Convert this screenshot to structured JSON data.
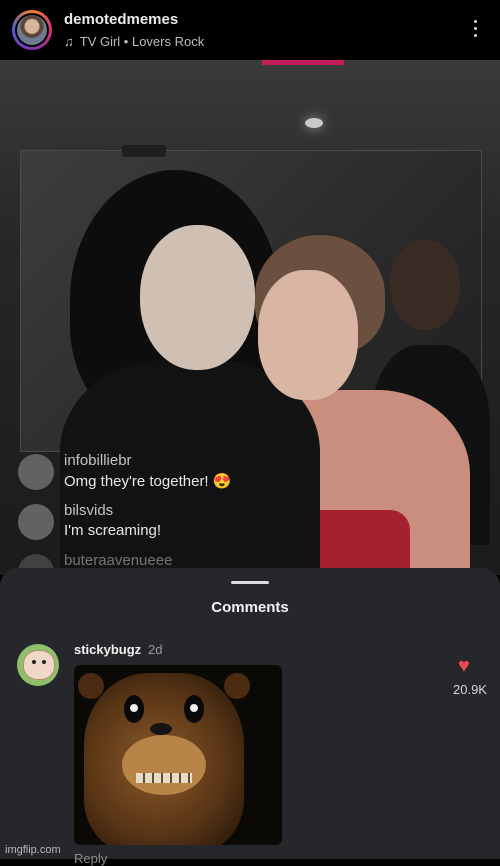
{
  "header": {
    "username": "demotedmemes",
    "music_icon": "music-note-icon",
    "music": "TV Girl • Lovers Rock",
    "more_icon": "more-vertical-icon"
  },
  "live_comments": [
    {
      "user": "infobilliebr",
      "text": "Omg they're together! 😍"
    },
    {
      "user": "bilsvids",
      "text": "I'm screaming!"
    },
    {
      "user": "buteraavenueee",
      "text": ""
    }
  ],
  "comments_sheet": {
    "title": "Comments",
    "comment": {
      "user": "stickybugz",
      "time": "2d",
      "like_icon": "heart-icon",
      "likes": "20.9K",
      "reply_peek": "Reply"
    }
  },
  "watermark": "imgflip.com",
  "colors": {
    "sheet_bg": "#26272b",
    "like_red": "#ed4956",
    "story_ring_start": "#f58529",
    "story_ring_end": "#515bd4"
  }
}
